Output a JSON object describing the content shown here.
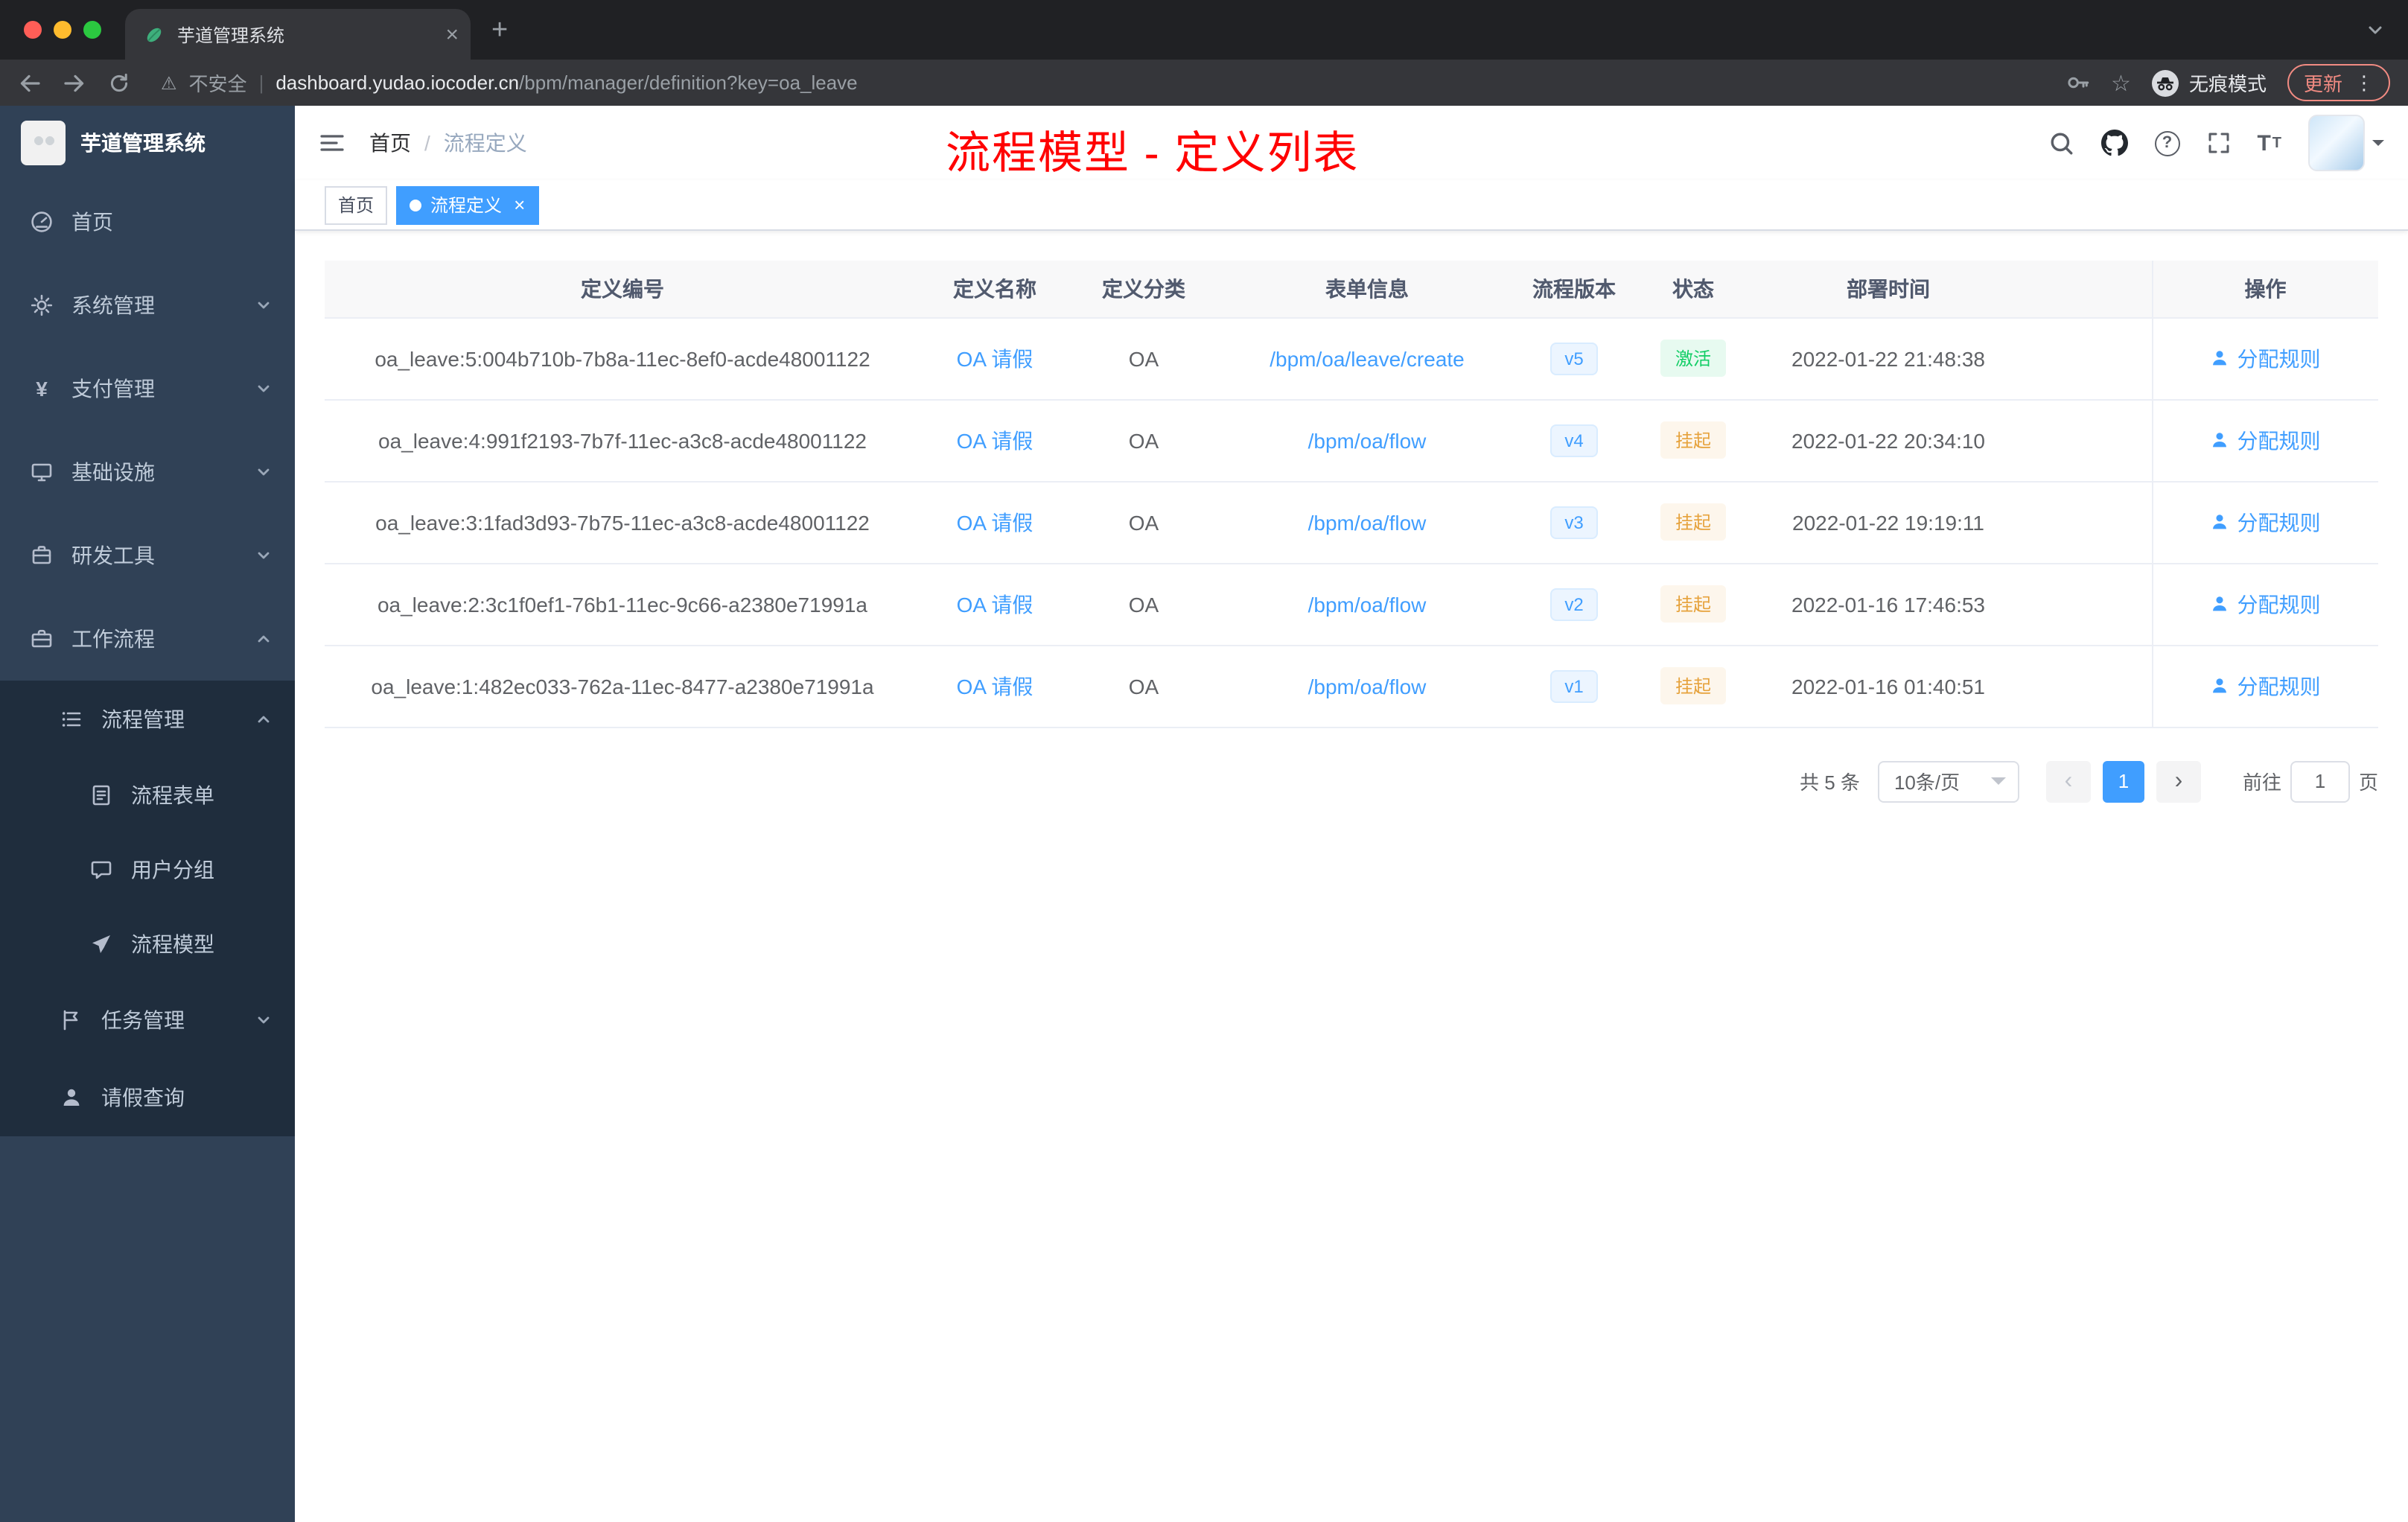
{
  "browser": {
    "tab_title": "芋道管理系统",
    "new_tab_glyph": "+",
    "close_glyph": "×",
    "warning_glyph": "⚠",
    "security_label": "不安全",
    "url_sep": "|",
    "url_domain": "dashboard.yudao.iocoder.cn",
    "url_path": "/bpm/manager/definition?key=oa_leave",
    "star_glyph": "☆",
    "incognito_label": "无痕模式",
    "update_label": "更新",
    "menu_dots_glyph": "⋮"
  },
  "sidebar": {
    "logo_title": "芋道管理系统",
    "items": [
      {
        "label": "首页"
      },
      {
        "label": "系统管理"
      },
      {
        "label": "支付管理"
      },
      {
        "label": "基础设施"
      },
      {
        "label": "研发工具"
      },
      {
        "label": "工作流程"
      }
    ],
    "yen_glyph": "¥",
    "workflow_menu": {
      "process_mgmt": "流程管理",
      "process_children": [
        "流程表单",
        "用户分组",
        "流程模型"
      ],
      "task_mgmt": "任务管理",
      "leave_query": "请假查询"
    }
  },
  "header": {
    "breadcrumb_home": "首页",
    "breadcrumb_separator": "/",
    "breadcrumb_current": "流程定义",
    "annotation": "流程模型 - 定义列表",
    "help_glyph": "?",
    "font_icon_large": "T",
    "font_icon_small": "T"
  },
  "tags": {
    "home": "首页",
    "active": "流程定义",
    "close_glyph": "×"
  },
  "table": {
    "columns": [
      "定义编号",
      "定义名称",
      "定义分类",
      "表单信息",
      "流程版本",
      "状态",
      "部署时间",
      "操作"
    ],
    "rows": [
      {
        "id": "oa_leave:5:004b710b-7b8a-11ec-8ef0-acde48001122",
        "name": "OA 请假",
        "category": "OA",
        "form": "/bpm/oa/leave/create",
        "version": "v5",
        "status": "激活",
        "time": "2022-01-22 21:48:38",
        "action": "分配规则"
      },
      {
        "id": "oa_leave:4:991f2193-7b7f-11ec-a3c8-acde48001122",
        "name": "OA 请假",
        "category": "OA",
        "form": "/bpm/oa/flow",
        "version": "v4",
        "status": "挂起",
        "time": "2022-01-22 20:34:10",
        "action": "分配规则"
      },
      {
        "id": "oa_leave:3:1fad3d93-7b75-11ec-a3c8-acde48001122",
        "name": "OA 请假",
        "category": "OA",
        "form": "/bpm/oa/flow",
        "version": "v3",
        "status": "挂起",
        "time": "2022-01-22 19:19:11",
        "action": "分配规则"
      },
      {
        "id": "oa_leave:2:3c1f0ef1-76b1-11ec-9c66-a2380e71991a",
        "name": "OA 请假",
        "category": "OA",
        "form": "/bpm/oa/flow",
        "version": "v2",
        "status": "挂起",
        "time": "2022-01-16 17:46:53",
        "action": "分配规则"
      },
      {
        "id": "oa_leave:1:482ec033-762a-11ec-8477-a2380e71991a",
        "name": "OA 请假",
        "category": "OA",
        "form": "/bpm/oa/flow",
        "version": "v1",
        "status": "挂起",
        "time": "2022-01-16 01:40:51",
        "action": "分配规则"
      }
    ]
  },
  "pagination": {
    "total_text": "共 5 条",
    "page_size": "10条/页",
    "prev_glyph": "‹",
    "next_glyph": "›",
    "current_page": "1",
    "goto_label": "前往",
    "goto_value": "1",
    "goto_unit": "页"
  },
  "colors": {
    "accent": "#409EFF",
    "success": "#13ce66",
    "warning": "#e6a23c",
    "annotation_red": "#ff0000",
    "sidebar_bg": "#304156",
    "submenu_bg": "#1f2d3d"
  }
}
